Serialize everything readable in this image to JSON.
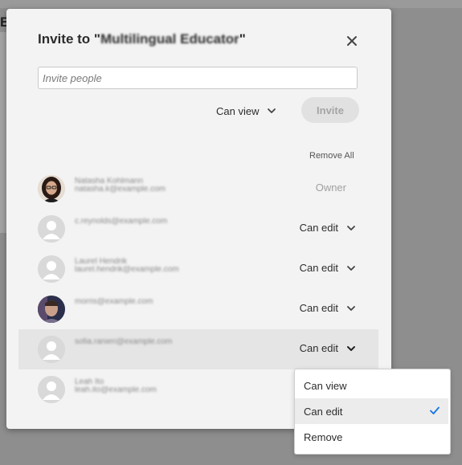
{
  "background": {
    "partial_letter": "E"
  },
  "dialog": {
    "title_prefix": "Invite to \"",
    "title_name": "Multilingual Educator",
    "title_suffix": "\"",
    "close_icon": "close-icon",
    "invite_input": {
      "placeholder": "Invite people",
      "value": ""
    },
    "permission_select": {
      "selected": "Can view"
    },
    "invite_button": "Invite",
    "remove_all": "Remove All",
    "members": [
      {
        "name_line1": "Natasha Kohlmann",
        "name_line2": "natasha.k@example.com",
        "role": "Owner",
        "avatar": "photo-woman"
      },
      {
        "name_line1": "c.reynolds@example.com",
        "name_line2": "",
        "role": "Can edit",
        "avatar": "placeholder"
      },
      {
        "name_line1": "Laurel Hendrik",
        "name_line2": "laurel.hendrik@example.com",
        "role": "Can edit",
        "avatar": "placeholder"
      },
      {
        "name_line1": "morris@example.com",
        "name_line2": "",
        "role": "Can edit",
        "avatar": "photo-man"
      },
      {
        "name_line1": "sofia.ranieri@example.com",
        "name_line2": "",
        "role": "Can edit",
        "avatar": "placeholder"
      },
      {
        "name_line1": "Leah Ito",
        "name_line2": "leah.ito@example.com",
        "role": "",
        "avatar": "placeholder"
      }
    ],
    "role_menu": {
      "items": [
        "Can view",
        "Can edit",
        "Remove"
      ],
      "selected": "Can edit",
      "check_icon": "checkmark-icon",
      "accent": "#1473e6"
    }
  }
}
